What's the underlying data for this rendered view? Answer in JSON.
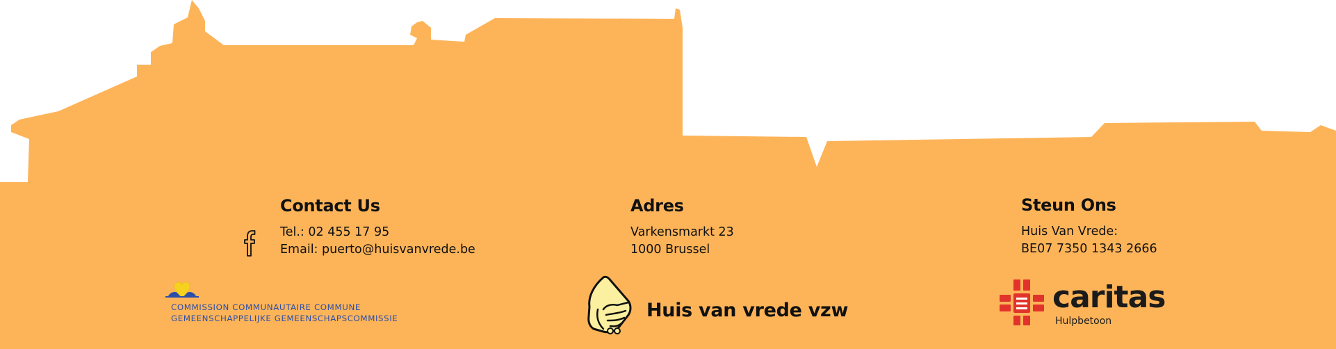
{
  "theme": {
    "background": "#FDB459",
    "text": "#111111",
    "ccc_blue": "#2B4EA8",
    "ccc_yellow": "#F6D21F",
    "caritas_red": "#E1332B"
  },
  "contact": {
    "heading": "Contact Us",
    "phone": "Tel.: 02 455 17 95",
    "email": "Email: puerto@huisvanvrede.be",
    "social_icon": "facebook-icon"
  },
  "adres": {
    "heading": "Adres",
    "street": "Varkensmarkt 23",
    "city": "1000 Brussel"
  },
  "steun": {
    "heading": "Steun Ons",
    "account_name": "Huis Van Vrede:",
    "iban": "BE07 7350 1343 2666"
  },
  "logos": {
    "ccc": {
      "line1": "COMMISSION COMMUNAUTAIRE COMMUNE",
      "line2": "GEMEENSCHAPPELIJKE GEMEENSCHAPSCOMMISSIE",
      "icon": "heart-icon"
    },
    "huis_van_vrede": {
      "name": "Huis van vrede vzw",
      "icon": "handshake-icon"
    },
    "caritas": {
      "name": "caritas",
      "subtitle": "Hulpbetoon",
      "icon": "caritas-cross-icon"
    }
  }
}
